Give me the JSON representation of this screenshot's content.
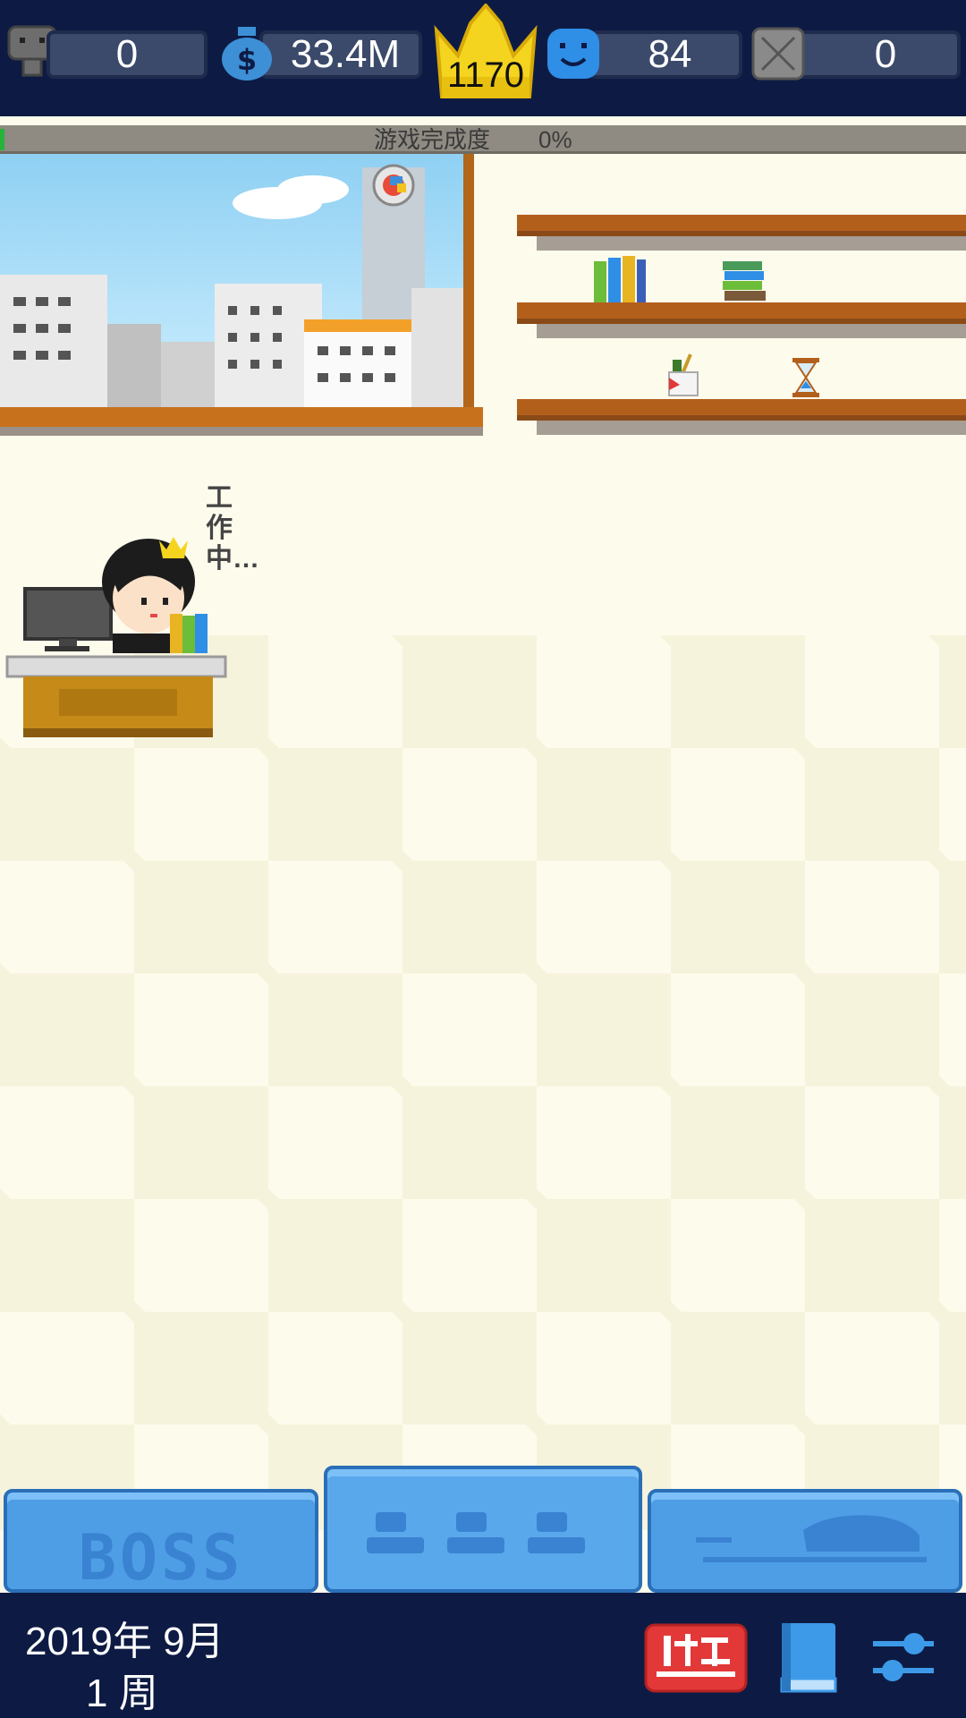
{
  "top_bar": {
    "employees": "0",
    "money": "33.4M",
    "crown_level": "1170",
    "happiness": "84",
    "locked_count": "0"
  },
  "progress": {
    "label": "游戏完成度",
    "value": "0%",
    "fraction": 0.0
  },
  "speech": {
    "text": "工作中…"
  },
  "tabs": [
    {
      "label": "BOSS"
    },
    {
      "label": "staff-icons"
    },
    {
      "label": "car-icon"
    }
  ],
  "status_bar": {
    "date": "2019年 9月",
    "week": "1 周"
  },
  "colors": {
    "bar_background": "#0d1b44",
    "tab_blue": "#4e9ee6",
    "coupon_red": "#e33838",
    "floor_light": "#fdfbec"
  }
}
